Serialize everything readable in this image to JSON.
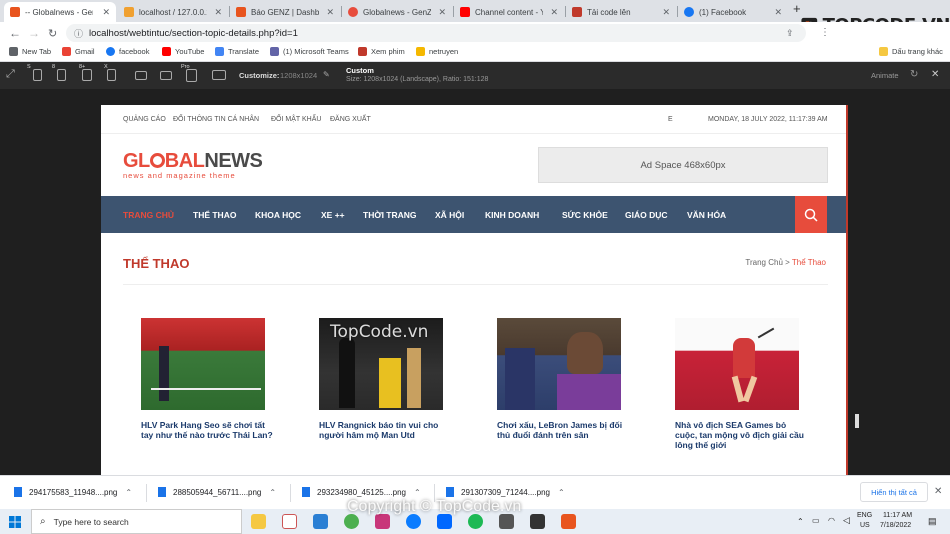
{
  "browser": {
    "tabs": [
      {
        "title": "-- Globalnews - GenZ",
        "color": "#e8541e"
      },
      {
        "title": "localhost / 127.0.0.1 /",
        "color": "#f0a030"
      },
      {
        "title": "Báo GENZ | Dashboard",
        "color": "#e8541e"
      },
      {
        "title": "Globalnews - GenZ",
        "color": "#e74c3c"
      },
      {
        "title": "Channel content - You",
        "color": "#ff0000"
      },
      {
        "title": "Tải code lên",
        "color": "#c0392b"
      },
      {
        "title": "(1) Facebook",
        "color": "#1877f2"
      }
    ],
    "url": "localhost/webtintuc/section-topic-details.php?id=1",
    "bookmarks": [
      {
        "label": "New Tab",
        "color": "#5f6368"
      },
      {
        "label": "Gmail",
        "color": "#ea4335"
      },
      {
        "label": "facebook",
        "color": "#1877f2"
      },
      {
        "label": "YouTube",
        "color": "#ff0000"
      },
      {
        "label": "Translate",
        "color": "#4285f4"
      },
      {
        "label": "(1) Microsoft Teams",
        "color": "#6264a7"
      },
      {
        "label": "Xem phim",
        "color": "#c0392b"
      },
      {
        "label": "netruyen",
        "color": "#f5b800"
      }
    ],
    "bookmarks_other": "Dấu trang khác"
  },
  "devtools": {
    "device_labels": [
      "S",
      "8",
      "8+",
      "X",
      "Pro"
    ],
    "customize_label": "Customize:",
    "customize_value": "1208x1024",
    "preset_name": "Custom",
    "preset_info": "Size: 1208x1024 (Landscape), Ratio: 151:128",
    "animate_label": "Animate"
  },
  "site": {
    "topbar": {
      "links": [
        "QUẢNG CÁO",
        "ĐỔI THÔNG TIN CÁ NHÂN",
        "ĐỔI MẬT KHẨU",
        "ĐĂNG XUẤT"
      ],
      "letter": "E",
      "date": "MONDAY, 18 JULY 2022, 11:17:39 AM"
    },
    "logo_part1": "GL",
    "logo_o": "O",
    "logo_part2": "BAL",
    "logo_part3": "NEWS",
    "logo_sub": "news and magazine theme",
    "ad_text": "Ad Space 468x60px",
    "nav": [
      "TRANG CHỦ",
      "THỂ THAO",
      "KHOA HỌC",
      "XE ++",
      "THỜI TRANG",
      "XÃ HỘI",
      "KINH DOANH",
      "SỨC KHỎE",
      "GIÁO DỤC",
      "VĂN HÓA"
    ],
    "section_title": "THỂ THAO",
    "breadcrumb_home": "Trang Chủ",
    "breadcrumb_current": "Thể Thao",
    "articles": [
      {
        "title": "HLV Park Hang Seo sẽ chơi tất tay như thế nào trước Thái Lan?",
        "bg": "#3a7a3a"
      },
      {
        "title": "HLV Rangnick báo tin vui cho người hâm mộ Man Utd",
        "bg": "#2a2a2a"
      },
      {
        "title": "Chơi xấu, LeBron James bị đối thủ đuổi đánh trên sân",
        "bg": "#3b4d7a"
      },
      {
        "title": "Nhà vô địch SEA Games bỏ cuộc, tan mộng vô địch giải cầu lông thế giới",
        "bg": "#c82238"
      }
    ]
  },
  "downloads": {
    "items": [
      "294175583_11948....png",
      "288505944_56711....png",
      "293234980_45125....png",
      "291307309_71244....png"
    ],
    "show_all": "Hiển thị tất cả"
  },
  "taskbar": {
    "search_placeholder": "Type here to search",
    "lang_top": "ENG",
    "lang_bottom": "US",
    "time": "11:17 AM",
    "date": "7/18/2022"
  },
  "watermark": {
    "center": "TopCode.vn",
    "bottom": "Copyright © TopCode.vn",
    "logo": "TOPCODE.VN"
  }
}
